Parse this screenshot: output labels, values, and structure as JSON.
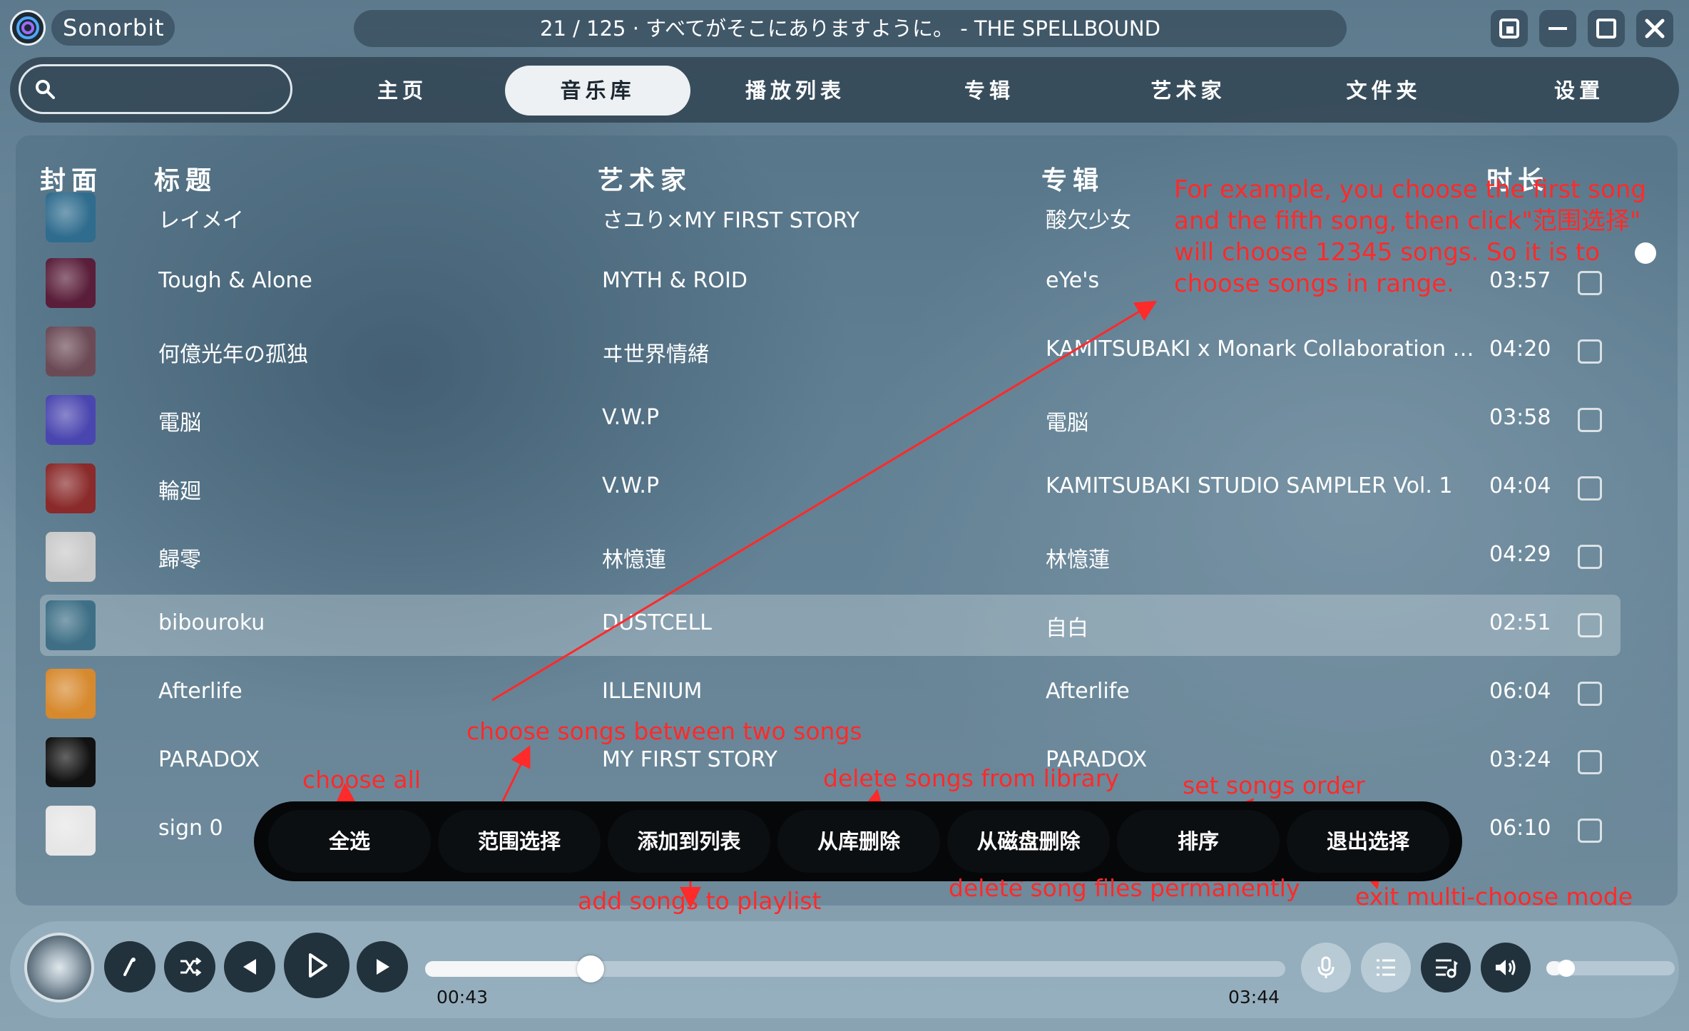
{
  "app": {
    "name": "Sonorbit"
  },
  "now_playing": {
    "title": "21 / 125 · すべてがそこにありますように。 - THE SPELLBOUND"
  },
  "search": {
    "placeholder": ""
  },
  "nav": [
    {
      "label": "主页",
      "active": false
    },
    {
      "label": "音乐库",
      "active": true
    },
    {
      "label": "播放列表",
      "active": false
    },
    {
      "label": "专辑",
      "active": false
    },
    {
      "label": "艺术家",
      "active": false
    },
    {
      "label": "文件夹",
      "active": false
    },
    {
      "label": "设置",
      "active": false
    }
  ],
  "table": {
    "headers": {
      "cover": "封面",
      "title": "标题",
      "artist": "艺术家",
      "album": "专辑",
      "duration": "时长"
    },
    "rows": [
      {
        "title": "レイメイ",
        "artist": "さユり×MY FIRST STORY",
        "album": "酸欠少女",
        "duration": "",
        "checked": false,
        "cover_color": "#2f6c8e"
      },
      {
        "title": "Tough & Alone",
        "artist": "MYTH & ROID",
        "album": "eYe's",
        "duration": "03:57",
        "checked": false,
        "cover_color": "#5a1e3a"
      },
      {
        "title": "何億光年の孤独",
        "artist": "ヰ世界情緒",
        "album": "KAMITSUBAKI x Monark Collaboration Albu...",
        "duration": "04:20",
        "checked": false,
        "cover_color": "#6b4a56"
      },
      {
        "title": "電脳",
        "artist": "V.W.P",
        "album": "電脳",
        "duration": "03:58",
        "checked": false,
        "cover_color": "#4a46b0"
      },
      {
        "title": "輪廻",
        "artist": "V.W.P",
        "album": "KAMITSUBAKI STUDIO SAMPLER Vol. 1",
        "duration": "04:04",
        "checked": false,
        "cover_color": "#8a2a2a"
      },
      {
        "title": "歸零",
        "artist": "林憶蓮",
        "album": "林憶蓮",
        "duration": "04:29",
        "checked": false,
        "cover_color": "#c9c9c9"
      },
      {
        "title": "bibouroku",
        "artist": "DUSTCELL",
        "album": "自白",
        "duration": "02:51",
        "checked": false,
        "cover_color": "#3e6f86",
        "highlight": true
      },
      {
        "title": "Afterlife",
        "artist": "ILLENIUM",
        "album": "Afterlife",
        "duration": "06:04",
        "checked": false,
        "cover_color": "#d7892e"
      },
      {
        "title": "PARADOX",
        "artist": "MY FIRST STORY",
        "album": "PARADOX",
        "duration": "03:24",
        "checked": false,
        "cover_color": "#111111"
      },
      {
        "title": "sign 0",
        "artist": "",
        "album": "",
        "duration": "06:10",
        "checked": false,
        "cover_color": "#e6e6e6"
      }
    ]
  },
  "toolbar": {
    "select_all": "全选",
    "range_select": "范围选择",
    "add_to_playlist": "添加到列表",
    "delete_from_library": "从库删除",
    "delete_from_disk": "从磁盘删除",
    "sort": "排序",
    "exit_select": "退出选择"
  },
  "annotations": {
    "range_example": "For example, you choose the first song and the fifth song, then click\"范围选择\" will choose 12345 songs. So it is to choose songs in range.",
    "choose_all": "choose all",
    "between_two": "choose songs between two songs",
    "delete_library": "delete songs from library",
    "set_order": "set songs order",
    "add_playlist": "add songs to playlist",
    "delete_files": "delete song files permanently",
    "exit_multi": "exit multi-choose mode",
    "color": "#ff2a2a"
  },
  "player": {
    "current_time": "00:43",
    "total_time": "03:44",
    "progress": 0.192,
    "volume": 0.12,
    "icons": [
      "lyrics-icon",
      "shuffle-icon",
      "previous-icon",
      "play-icon",
      "next-icon",
      "microphone-icon",
      "list-icon",
      "queue-icon",
      "volume-icon"
    ]
  },
  "colors": {
    "accent_active_tab": "#edf1f3",
    "panel": "#30424f"
  }
}
